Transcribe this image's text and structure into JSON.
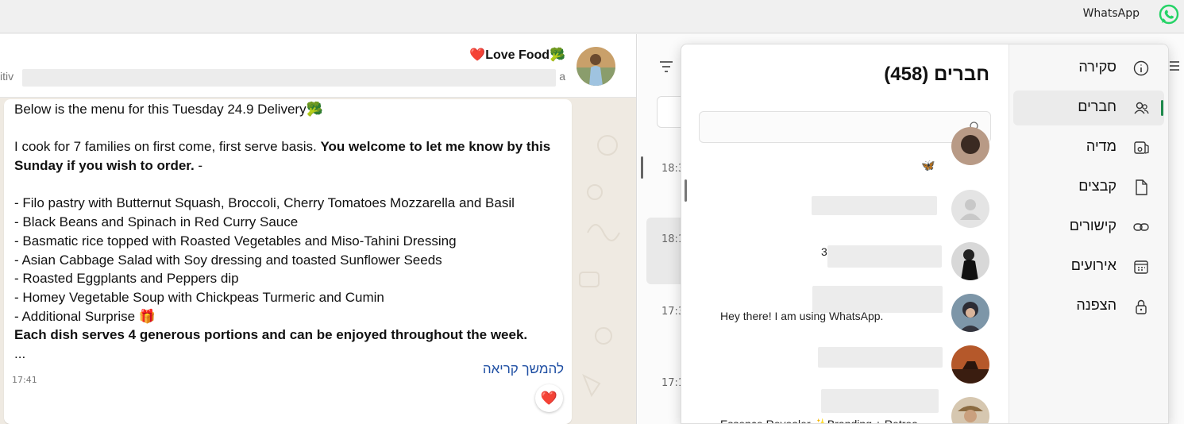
{
  "window": {
    "app_name": "WhatsApp",
    "brand_color": "#25D366"
  },
  "chat": {
    "group_name": "❤️Love Food🥦",
    "subtitle_start": "itiv",
    "subtitle_end": "a",
    "message": {
      "lines": [
        "Below is the menu for this Tuesday 24.9 Delivery🥦",
        "",
        "I cook for 7 families on first come, first serve basis. ",
        "Sunday if you wish to order.",
        "",
        "- Filo pastry with Butternut Squash, Broccoli, Cherry Tomatoes Mozzarella and Basil",
        "- Black Beans and Spinach in Red Curry Sauce",
        "- Basmatic rice topped with Roasted Vegetables and Miso-Tahini Dressing",
        "- Asian Cabbage Salad with Soy dressing and toasted Sunflower Seeds",
        "- Roasted Eggplants and Peppers dip",
        "- Homey Vegetable Soup with Chickpeas Turmeric and Cumin",
        "- Additional Surprise 🎁",
        "Each dish serves 4 generous portions and can be enjoyed throughout the week.",
        "..."
      ],
      "bold_tail": "You welcome to let me know by this",
      "line4_tail": " -",
      "read_more": "להמשך קריאה",
      "time": "17:41",
      "reaction": "❤️"
    }
  },
  "chat_list": {
    "times": [
      "18:3",
      "18:1",
      "17:3",
      "17:1"
    ]
  },
  "group_info": {
    "nav": [
      {
        "label": "סקירה",
        "icon": "info-icon"
      },
      {
        "label": "חברים",
        "icon": "members-icon",
        "active": true
      },
      {
        "label": "מדיה",
        "icon": "media-icon"
      },
      {
        "label": "קבצים",
        "icon": "file-icon"
      },
      {
        "label": "קישורים",
        "icon": "link-icon"
      },
      {
        "label": "אירועים",
        "icon": "calendar-icon"
      },
      {
        "label": "הצפנה",
        "icon": "lock-icon"
      }
    ],
    "title": "חברים (458)",
    "search_value": "",
    "members": [
      {
        "status": "🦋"
      },
      {
        "status": ""
      },
      {
        "status": "3"
      },
      {
        "status": "Hey there! I am using WhatsApp."
      },
      {
        "status": ""
      },
      {
        "status": "Essence Revealer ✨Branding + Retrea"
      }
    ]
  }
}
